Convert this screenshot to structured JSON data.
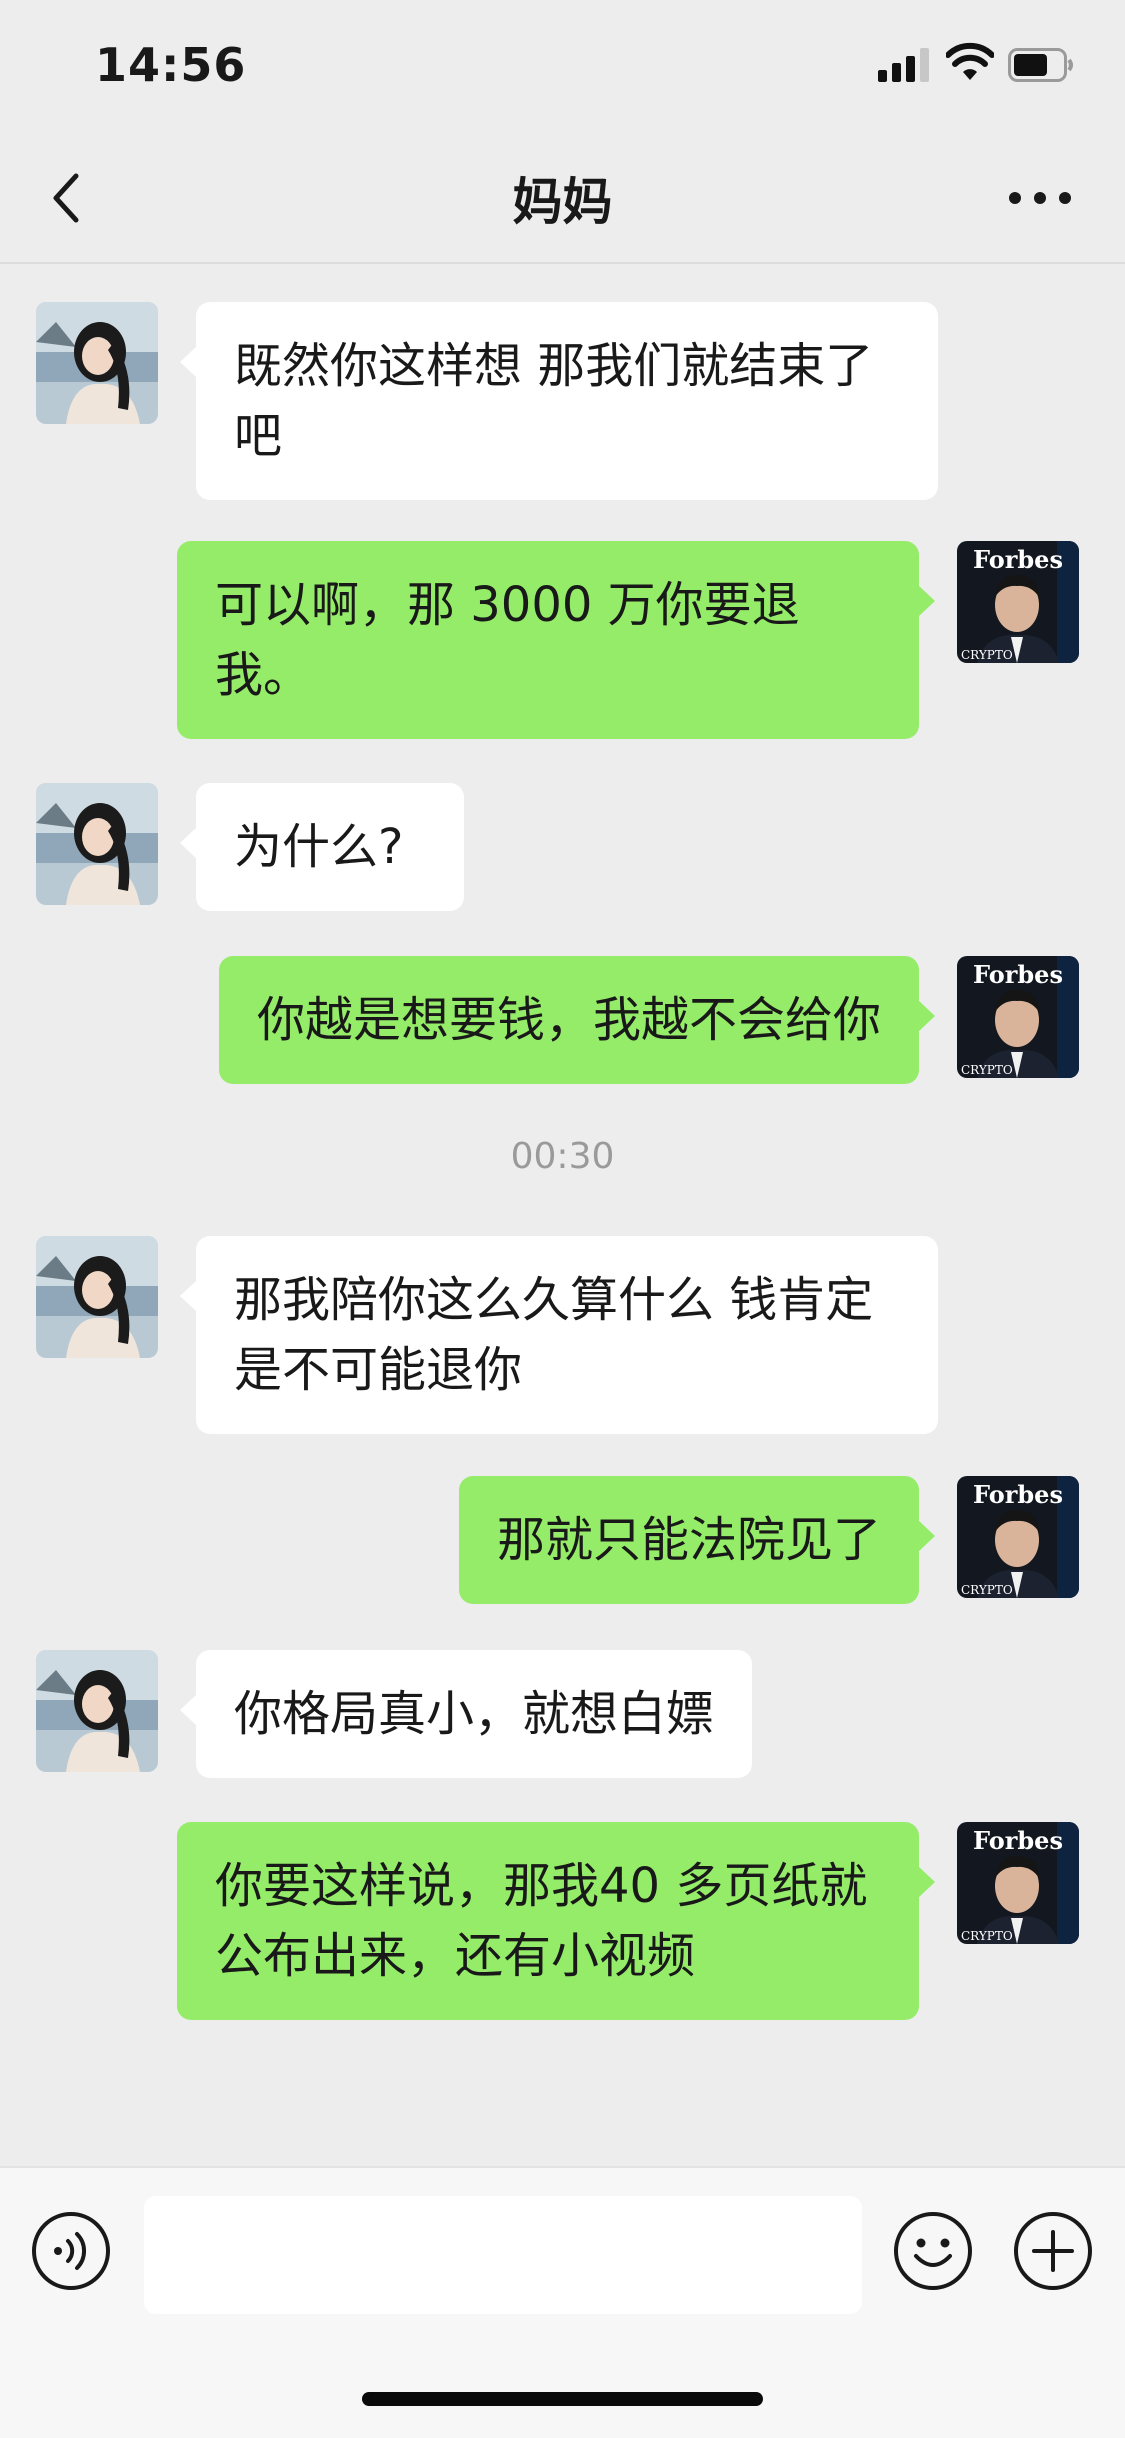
{
  "status_bar": {
    "time": "14:56"
  },
  "header": {
    "title": "妈妈"
  },
  "messages": [
    {
      "side": "in",
      "text": "既然你这样想 那我们就结束了吧"
    },
    {
      "side": "out",
      "text": "可以啊，那 3000 万你要退我。"
    },
    {
      "side": "in",
      "text": "为什么?"
    },
    {
      "side": "out",
      "text": "你越是想要钱，我越不会给你"
    },
    {
      "side": "in",
      "text": "那我陪你这么久算什么 钱肯定是不可能退你"
    },
    {
      "side": "out",
      "text": "那就只能法院见了"
    },
    {
      "side": "in",
      "text": "你格局真小，就想白嫖"
    },
    {
      "side": "out",
      "text": "你要这样说，那我40 多页纸就公布出来，还有小视频"
    }
  ],
  "timestamp": "00:30",
  "avatars": {
    "contact": "woman-photo",
    "self": "forbes-magazine-cover",
    "self_cover_text": "Forbes",
    "self_cover_subtext": "CRYPTO"
  },
  "input": {
    "value": ""
  },
  "icons": {
    "back": "chevron-left-icon",
    "more": "more-dots-icon",
    "voice": "voice-icon",
    "emoji": "emoji-icon",
    "plus": "plus-icon"
  },
  "colors": {
    "outgoing_bubble": "#95ec69",
    "incoming_bubble": "#ffffff",
    "background": "#ededed"
  }
}
